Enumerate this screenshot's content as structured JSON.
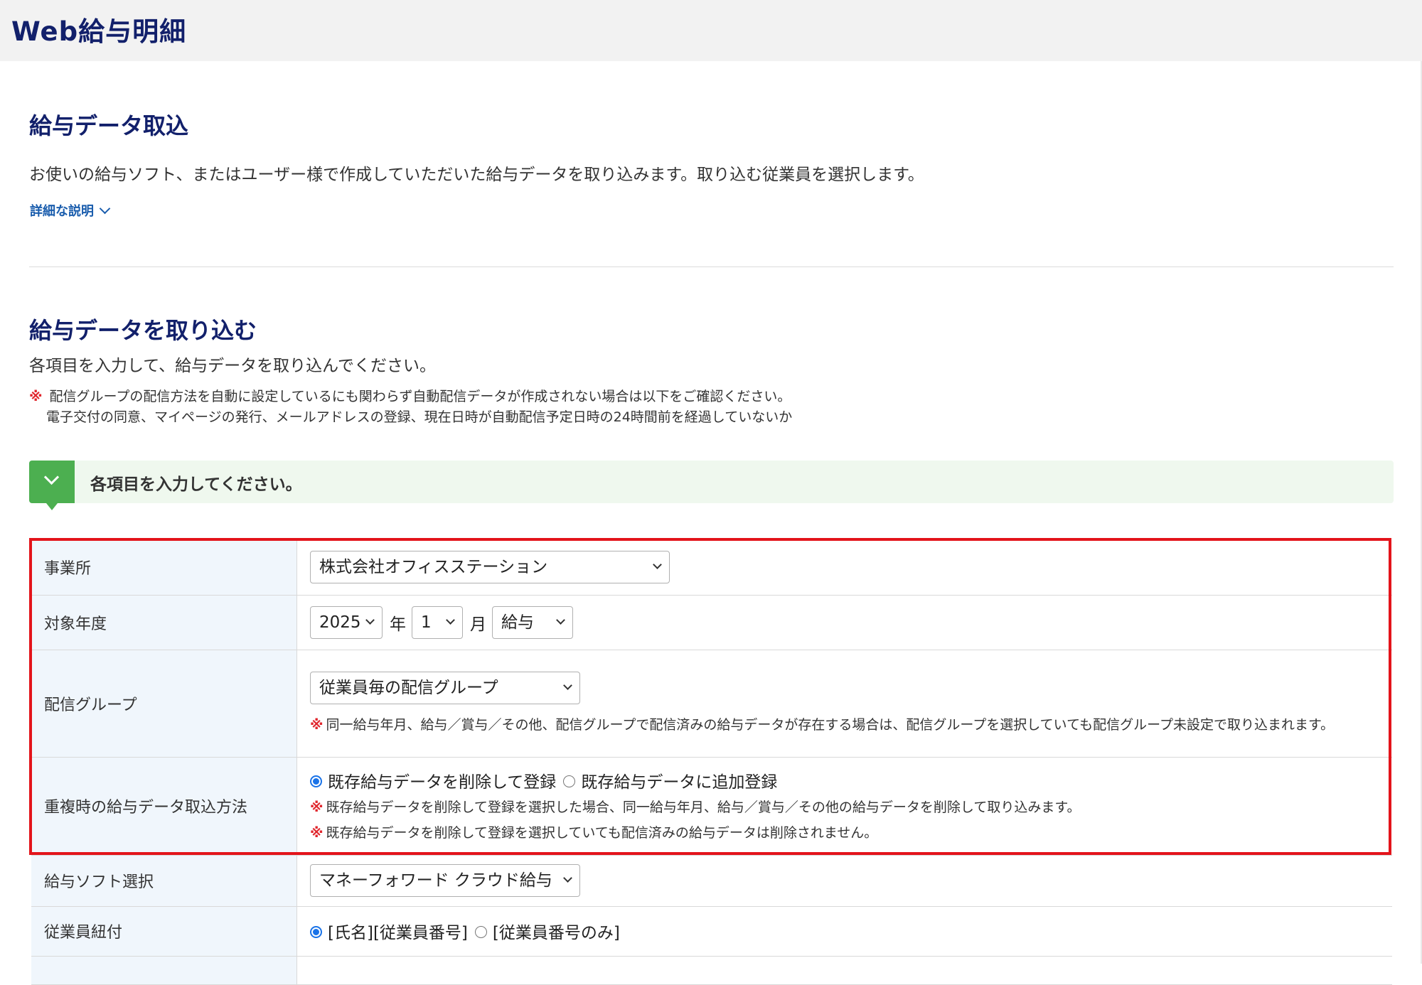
{
  "header": {
    "app_title": "Web給与明細"
  },
  "section1": {
    "title": "給与データ取込",
    "description": "お使いの給与ソフト、またはユーザー様で作成していただいた給与データを取り込みます。取り込む従業員を選択します。",
    "details_link": "詳細な説明"
  },
  "section2": {
    "title": "給与データを取り込む",
    "description": "各項目を入力して、給与データを取り込んでください。",
    "note_mark": "※",
    "note_line1": "配信グループの配信方法を自動に設定しているにも関わらず自動配信データが作成されない場合は以下をご確認ください。",
    "note_line2": "電子交付の同意、マイページの発行、メールアドレスの登録、現在日時が自動配信予定日時の24時間前を経過していないか"
  },
  "banner": {
    "text": "各項目を入力してください。"
  },
  "form": {
    "office": {
      "label": "事業所",
      "value": "株式会社オフィスステーション"
    },
    "target_period": {
      "label": "対象年度",
      "year": "2025",
      "year_unit": "年",
      "month": "1",
      "month_unit": "月",
      "type": "給与"
    },
    "delivery_group": {
      "label": "配信グループ",
      "value": "従業員毎の配信グループ",
      "note_mark": "※",
      "note": "同一給与年月、給与／賞与／その他、配信グループで配信済みの給与データが存在する場合は、配信グループを選択していても配信グループ未設定で取り込まれます。"
    },
    "duplicate_method": {
      "label": "重複時の給与データ取込方法",
      "option1": "既存給与データを削除して登録",
      "option2": "既存給与データに追加登録",
      "selected": "option1",
      "note_mark": "※",
      "note1": "既存給与データを削除して登録を選択した場合、同一給与年月、給与／賞与／その他の給与データを削除して取り込みます。",
      "note2": "既存給与データを削除して登録を選択していても配信済みの給与データは削除されません。"
    },
    "software": {
      "label": "給与ソフト選択",
      "value": "マネーフォワード クラウド給与"
    },
    "employee_link": {
      "label": "従業員紐付",
      "option1": "[氏名][従業員番号]",
      "option2": "[従業員番号のみ]",
      "selected": "option1"
    }
  },
  "colors": {
    "title": "#12206b",
    "link": "#1a5dad",
    "accent_green": "#4caf50",
    "highlight_red": "#e3141b",
    "note_mark": "#e0262d"
  }
}
